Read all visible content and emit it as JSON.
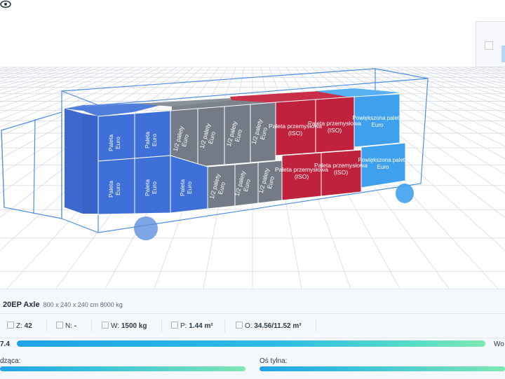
{
  "colors": {
    "euro": "#3f6fd8",
    "half_euro": "#747b86",
    "industrial": "#c0213d",
    "enlarged": "#3fa1ee",
    "grid": "#d4dae3",
    "progress_start": "#1fa3e6",
    "progress_end": "#7ee8b2"
  },
  "cargo": {
    "euro_label": "Paleta Euro",
    "half_euro_label": "1/2 palety Euro",
    "industrial_label": "Paleta przemysłowa (ISO)",
    "enlarged_label": "Powiększona paleta Euro"
  },
  "vehicle": {
    "name": "20EP Axle",
    "dims": "800 x 240 x 240 cm 8000 kg"
  },
  "stats": {
    "z_label": "Z:",
    "z_value": "42",
    "n_label": "N:",
    "n_value": "-",
    "w_label": "W:",
    "w_value": "1500 kg",
    "p_label": "P:",
    "p_value": "1.44 m²",
    "o_label": "O:",
    "o_value": "34.56/11.52 m³"
  },
  "progress": {
    "left_text": "7.4",
    "right_text": "Wo",
    "fill_fraction": 1.0
  },
  "axles": {
    "front_label": "dząca:",
    "rear_label": "Oś tylna:"
  },
  "icons": [
    "stack-icon",
    "weight-icon",
    "area-icon",
    "volume-icon",
    "eye-icon",
    "view-cube-icon"
  ]
}
